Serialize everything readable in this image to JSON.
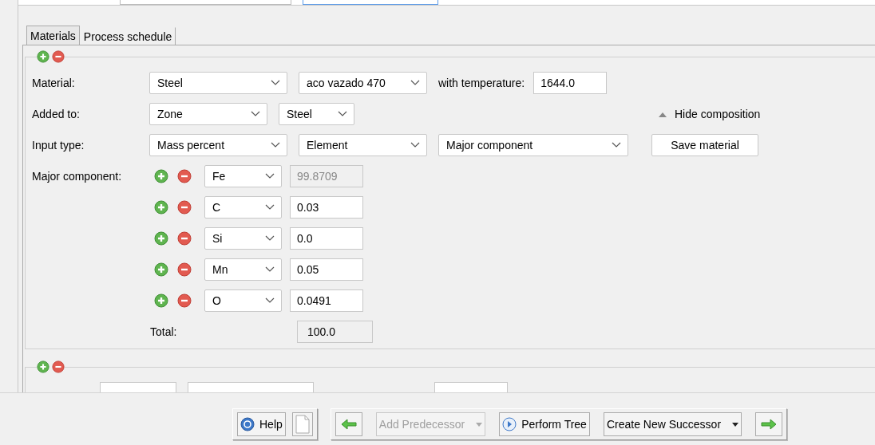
{
  "tabs": [
    {
      "label": "Materials",
      "selected": true
    },
    {
      "label": "Process schedule",
      "selected": false
    }
  ],
  "material": {
    "label": "Material:",
    "type": "Steel",
    "grade": "aco vazado 470",
    "temperature_label": "with temperature:",
    "temperature": "1644.0"
  },
  "added_to": {
    "label": "Added to:",
    "target": "Zone",
    "zone": "Steel"
  },
  "composition_toggle": {
    "label": "Hide composition",
    "expanded": true
  },
  "input_type": {
    "label": "Input type:",
    "unit": "Mass percent",
    "basis": "Element",
    "mode": "Major component",
    "save": "Save material"
  },
  "components": {
    "label": "Major component:",
    "rows": [
      {
        "element": "Fe",
        "value": "99.8709",
        "disabled": true
      },
      {
        "element": "C",
        "value": "0.03",
        "disabled": false
      },
      {
        "element": "Si",
        "value": "0.0",
        "disabled": false
      },
      {
        "element": "Mn",
        "value": "0.05",
        "disabled": false
      },
      {
        "element": "O",
        "value": "0.0491",
        "disabled": false
      }
    ]
  },
  "total": {
    "label": "Total:",
    "value": "100.0"
  },
  "toolbar": [
    {
      "buttons": [
        {
          "kind": "help",
          "label": "Help",
          "disabled": false
        },
        {
          "kind": "page",
          "disabled": false
        }
      ]
    },
    {
      "buttons": [
        {
          "kind": "back",
          "disabled": false
        },
        {
          "kind": "menu",
          "label": "Add Predecessor",
          "disabled": true
        },
        {
          "kind": "run",
          "label": "Perform Tree",
          "disabled": false
        },
        {
          "kind": "menu",
          "label": "Create New Successor",
          "disabled": false
        },
        {
          "kind": "forward",
          "disabled": false
        }
      ]
    }
  ]
}
